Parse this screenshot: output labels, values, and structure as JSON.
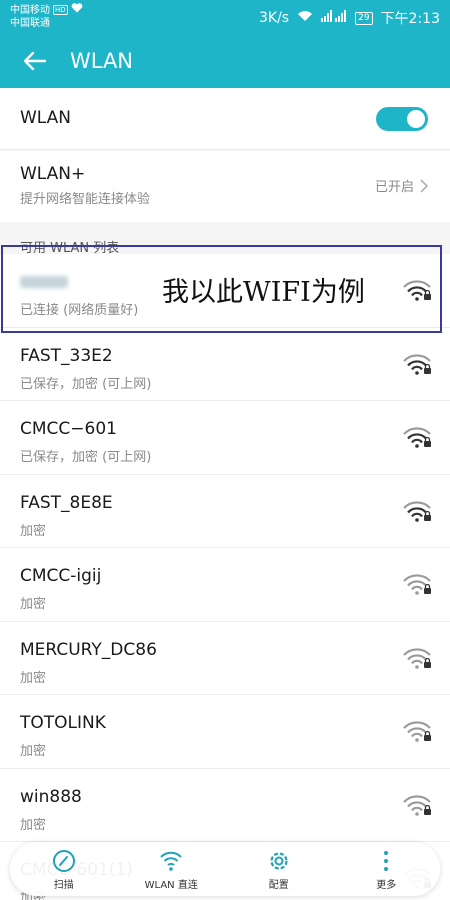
{
  "statusbar": {
    "carrier1": "中国移动",
    "carrier1_badge": "HD",
    "carrier2": "中国联通",
    "speed": "3K/s",
    "battery": "29",
    "time": "下午2:13"
  },
  "appbar": {
    "title": "WLAN"
  },
  "wlan_row": {
    "title": "WLAN",
    "enabled": true
  },
  "wlan_plus_row": {
    "title": "WLAN+",
    "subtitle": "提升网络智能连接体验",
    "value": "已开启"
  },
  "section_label": "可用 WLAN 列表",
  "annotation": "我以此WIFI为例",
  "networks": [
    {
      "name": "",
      "status": "已连接 (网络质量好)"
    },
    {
      "name": "FAST_33E2",
      "status": "已保存，加密 (可上网)"
    },
    {
      "name": "CMCC−601",
      "status": "已保存，加密 (可上网)"
    },
    {
      "name": "FAST_8E8E",
      "status": "加密"
    },
    {
      "name": "CMCC-igij",
      "status": "加密"
    },
    {
      "name": "MERCURY_DC86",
      "status": "加密"
    },
    {
      "name": "TOTOLINK",
      "status": "加密"
    },
    {
      "name": "win888",
      "status": "加密"
    },
    {
      "name": "CMCC-601(1)",
      "status": "加密"
    }
  ],
  "bottom_tabs": [
    {
      "label": "扫描",
      "icon": "scan-icon"
    },
    {
      "label": "WLAN 直连",
      "icon": "wifi-direct-icon"
    },
    {
      "label": "配置",
      "icon": "gear-icon"
    },
    {
      "label": "更多",
      "icon": "more-icon"
    }
  ],
  "colors": {
    "accent": "#1fb5c8",
    "highlight_box": "#3a3a9c"
  }
}
